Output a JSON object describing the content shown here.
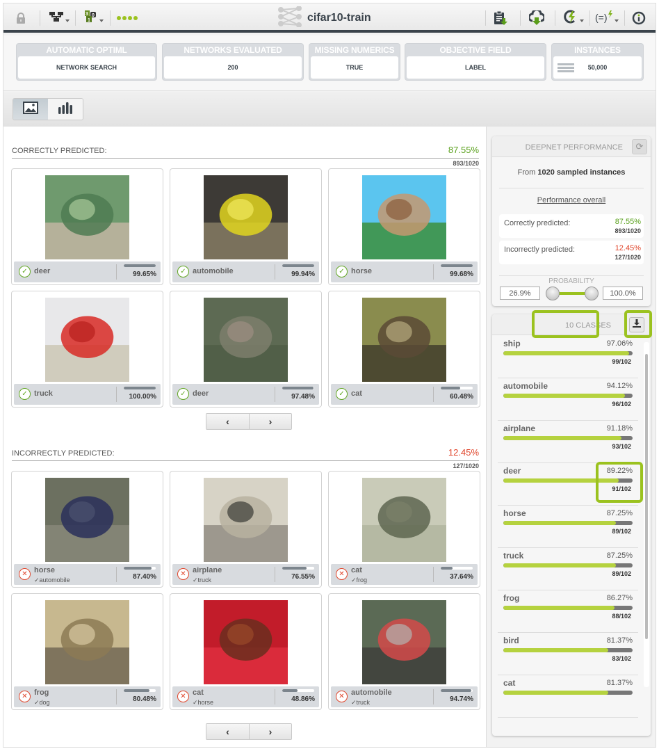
{
  "toolbar": {
    "title": "cifar10-train",
    "left_icons": [
      "lock-icon",
      "tree-icon",
      "counter-icon",
      "status-dots"
    ],
    "right_icons": [
      "clipboard-download-icon",
      "cloud-download-icon",
      "lightning-cycle-icon",
      "formula-lightning-icon",
      "info-icon"
    ]
  },
  "summary": [
    {
      "label": "AUTOMATIC OPTIML",
      "value": "NETWORK SEARCH"
    },
    {
      "label": "NETWORKS EVALUATED",
      "value": "200"
    },
    {
      "label": "MISSING NUMERICS",
      "value": "TRUE"
    },
    {
      "label": "OBJECTIVE FIELD",
      "value": "LABEL"
    },
    {
      "label": "INSTANCES",
      "value": "50,000"
    }
  ],
  "views": [
    {
      "name": "images-view",
      "active": true
    },
    {
      "name": "chart-view",
      "active": false
    }
  ],
  "correct": {
    "title": "CORRECTLY PREDICTED:",
    "pct": "87.55%",
    "count": "893/1020",
    "cards": [
      {
        "pred": "deer",
        "conf": "99.65%",
        "confv": 0.9965,
        "img": [
          "#6f9a6e",
          "#4f7b52",
          "#a9c99a",
          "#c7b6a5"
        ]
      },
      {
        "pred": "automobile",
        "conf": "99.94%",
        "confv": 0.9994,
        "img": [
          "#3d3a36",
          "#e0d51e",
          "#f1e95d",
          "#8a7f66"
        ]
      },
      {
        "pred": "horse",
        "conf": "99.68%",
        "confv": 0.9968,
        "img": [
          "#5bc5ef",
          "#c59870",
          "#8a5d3a",
          "#3b8c32"
        ]
      },
      {
        "pred": "truck",
        "conf": "100.00%",
        "confv": 1.0,
        "img": [
          "#e8e8ea",
          "#d82a26",
          "#b81f1d",
          "#c9c4b2"
        ]
      },
      {
        "pred": "deer",
        "conf": "97.48%",
        "confv": 0.9748,
        "img": [
          "#5d6a53",
          "#7d7e6c",
          "#9d8f82",
          "#4f5d46"
        ]
      },
      {
        "pred": "cat",
        "conf": "60.48%",
        "confv": 0.6048,
        "img": [
          "#8a8c4e",
          "#5a4a36",
          "#b6aa7e",
          "#3d3a2a"
        ]
      }
    ]
  },
  "incorrect": {
    "title": "INCORRECTLY PREDICTED:",
    "pct": "12.45%",
    "count": "127/1020",
    "cards": [
      {
        "pred": "horse",
        "actual": "automobile",
        "conf": "87.40%",
        "confv": 0.874,
        "img": [
          "#6c7060",
          "#2a2f5a",
          "#4c516f",
          "#8a8a7a"
        ]
      },
      {
        "pred": "airplane",
        "actual": "truck",
        "conf": "76.55%",
        "confv": 0.7655,
        "img": [
          "#d7d3c6",
          "#b9b2a0",
          "#3b3a36",
          "#8f8a7f"
        ]
      },
      {
        "pred": "cat",
        "actual": "frog",
        "conf": "37.64%",
        "confv": 0.3764,
        "img": [
          "#c9cbb8",
          "#5e6650",
          "#7a806a",
          "#b0b49e"
        ]
      },
      {
        "pred": "frog",
        "actual": "dog",
        "conf": "80.48%",
        "confv": 0.8048,
        "img": [
          "#c7b88f",
          "#8c7a55",
          "#d9c9a2",
          "#6d6350"
        ]
      },
      {
        "pred": "cat",
        "actual": "horse",
        "conf": "48.86%",
        "confv": 0.4886,
        "img": [
          "#c21c2a",
          "#6a2e1f",
          "#9a4a2a",
          "#e03040"
        ]
      },
      {
        "pred": "automobile",
        "actual": "truck",
        "conf": "94.74%",
        "confv": 0.9474,
        "img": [
          "#5b6a55",
          "#d44a4a",
          "#b4b4b0",
          "#3d3d3a"
        ]
      }
    ]
  },
  "performance": {
    "title": "DEEPNET PERFORMANCE",
    "from_prefix": "From ",
    "from_bold": "1020 sampled instances",
    "overall_link": "Performance overall",
    "correct_label": "Correctly predicted:",
    "correct_pct": "87.55%",
    "correct_count": "893/1020",
    "incorrect_label": "Incorrectly predicted:",
    "incorrect_pct": "12.45%",
    "incorrect_count": "127/1020",
    "prob_label": "PROBABILITY",
    "prob_min": "26.9%",
    "prob_max": "100.0%"
  },
  "classes": {
    "title": "10 CLASSES",
    "items": [
      {
        "name": "ship",
        "pct": "97.06%",
        "value": 0.9706,
        "count": "99/102"
      },
      {
        "name": "automobile",
        "pct": "94.12%",
        "value": 0.9412,
        "count": "96/102"
      },
      {
        "name": "airplane",
        "pct": "91.18%",
        "value": 0.9118,
        "count": "93/102"
      },
      {
        "name": "deer",
        "pct": "89.22%",
        "value": 0.8922,
        "count": "91/102",
        "highlight": true
      },
      {
        "name": "horse",
        "pct": "87.25%",
        "value": 0.8725,
        "count": "89/102"
      },
      {
        "name": "truck",
        "pct": "87.25%",
        "value": 0.8725,
        "count": "89/102"
      },
      {
        "name": "frog",
        "pct": "86.27%",
        "value": 0.8627,
        "count": "88/102"
      },
      {
        "name": "bird",
        "pct": "81.37%",
        "value": 0.8137,
        "count": "83/102"
      },
      {
        "name": "cat",
        "pct": "81.37%",
        "value": 0.8137,
        "count": ""
      }
    ]
  },
  "colors": {
    "accent": "#9bc21f",
    "correct": "#5aa11d",
    "incorrect": "#e0452b",
    "bar_fill": "#b5d23f",
    "bar_bg": "#777777"
  }
}
